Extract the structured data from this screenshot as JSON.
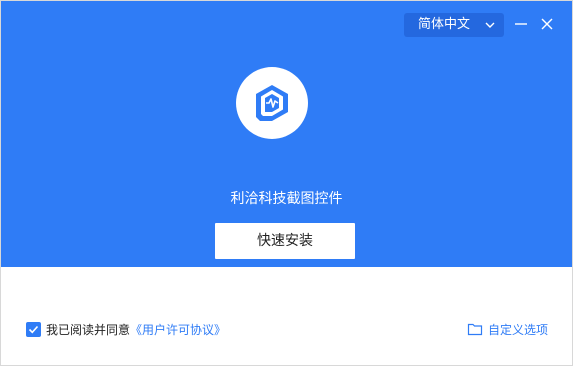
{
  "header": {
    "language_select": "简体中文",
    "product_name": "利洽科技截图控件",
    "install_button": "快速安装"
  },
  "footer": {
    "agree_text": "我已阅读并同意",
    "agreement_link": "《用户许可协议》",
    "agree_checked": true,
    "custom_options": "自定义选项"
  },
  "colors": {
    "accent": "#2f7cf6",
    "header_bg": "#2f7cf6",
    "language_select_bg": "#2468df"
  },
  "icons": [
    "chevron-down-icon",
    "minimize-icon",
    "close-icon",
    "app-logo-icon",
    "checkmark-icon",
    "folder-icon"
  ]
}
